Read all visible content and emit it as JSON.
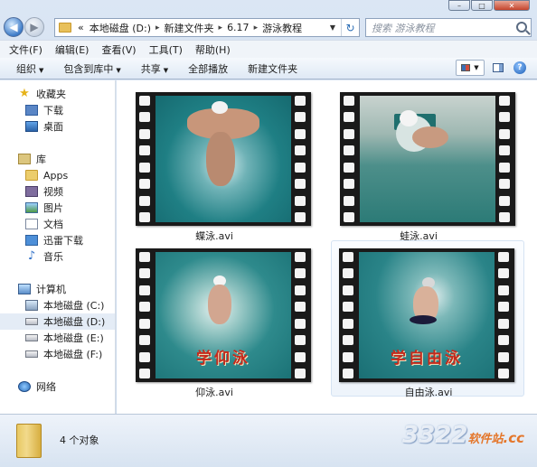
{
  "window": {
    "caption_buttons": [
      "–",
      "□",
      "✕"
    ]
  },
  "address": {
    "chevron": "«",
    "segments": [
      "本地磁盘 (D:)",
      "新建文件夹",
      "6.17",
      "游泳教程"
    ],
    "search_placeholder": "搜索 游泳教程"
  },
  "menu": [
    "文件(F)",
    "编辑(E)",
    "查看(V)",
    "工具(T)",
    "帮助(H)"
  ],
  "toolbar": {
    "organize": "组织",
    "include_library": "包含到库中",
    "share": "共享",
    "play_all": "全部播放",
    "new_folder": "新建文件夹"
  },
  "nav": {
    "favorites": "收藏夹",
    "downloads": "下载",
    "desktop": "桌面",
    "libraries": "库",
    "apps": "Apps",
    "videos": "视频",
    "pictures": "图片",
    "documents": "文档",
    "thunder": "迅雷下载",
    "music": "音乐",
    "computer": "计算机",
    "drive_c": "本地磁盘 (C:)",
    "drive_d": "本地磁盘 (D:)",
    "drive_e": "本地磁盘 (E:)",
    "drive_f": "本地磁盘 (F:)",
    "network": "网络"
  },
  "files": [
    {
      "name": "蝶泳.avi",
      "overlay": ""
    },
    {
      "name": "蛙泳.avi",
      "overlay": ""
    },
    {
      "name": "仰泳.avi",
      "overlay": "学仰泳"
    },
    {
      "name": "自由泳.avi",
      "overlay": "学自由泳"
    }
  ],
  "status": {
    "count": "4 个对象"
  },
  "watermark": {
    "digits": "3322",
    "site": "软件站",
    "tld": ".cc"
  },
  "icons": {
    "back": "arrow-left-icon",
    "forward": "arrow-right-icon",
    "refresh": "refresh-icon",
    "search": "search-icon",
    "view": "view-options-icon",
    "preview": "preview-pane-icon",
    "help": "help-icon"
  }
}
